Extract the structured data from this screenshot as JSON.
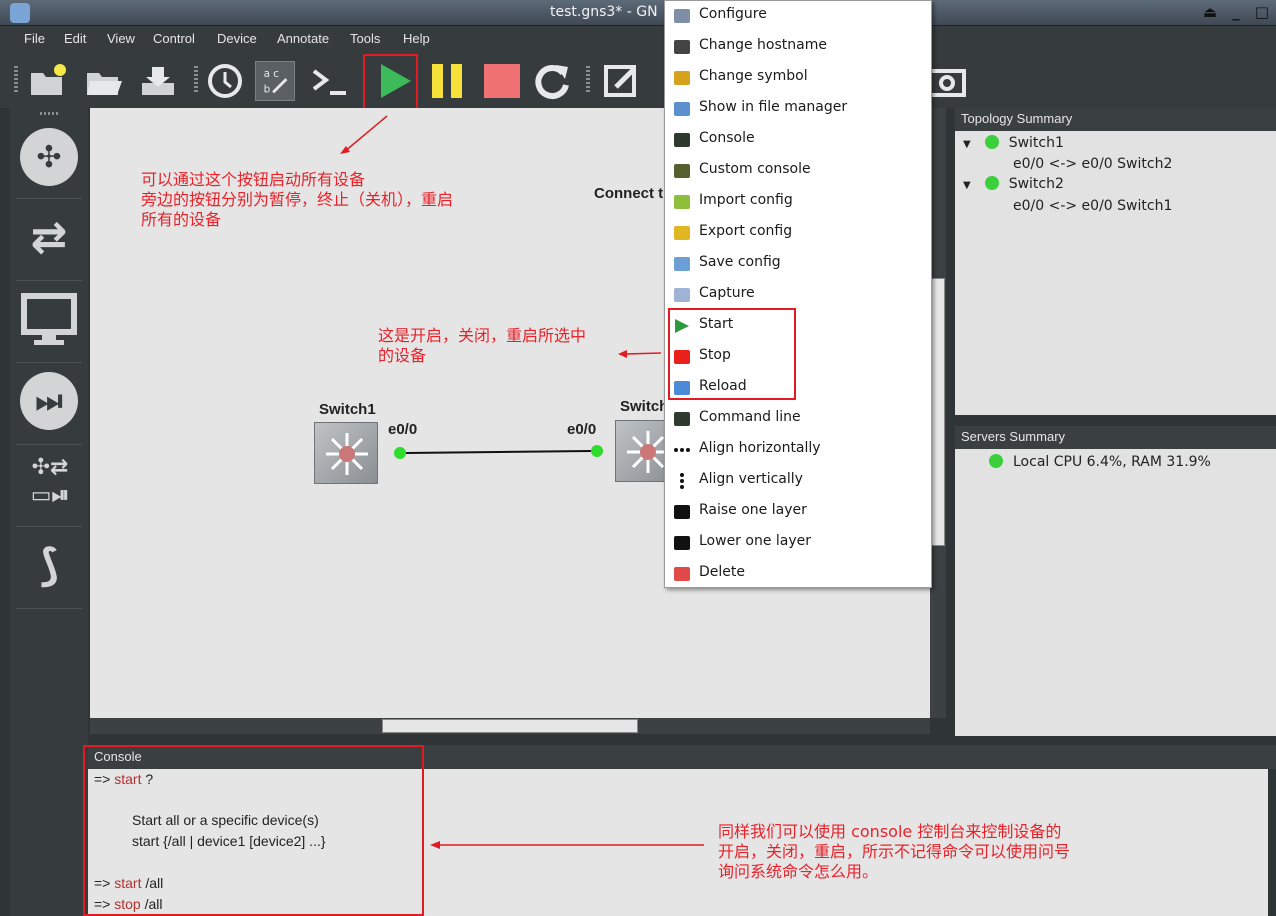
{
  "window": {
    "title": "test.gns3* - GN"
  },
  "menubar": [
    "File",
    "Edit",
    "View",
    "Control",
    "Device",
    "Annotate",
    "Tools",
    "Help"
  ],
  "toolbar_icons": [
    "new-project-icon",
    "open-project-icon",
    "save-project-icon",
    "snapshot-icon",
    "show-interface-labels-icon",
    "console-all-icon",
    "start-all-icon",
    "suspend-all-icon",
    "stop-all-icon",
    "reload-all-icon",
    "add-note-icon",
    "screenshot-icon"
  ],
  "palette_icons": [
    "routers-icon",
    "switches-icon",
    "end-devices-icon",
    "security-devices-icon",
    "all-devices-icon",
    "add-link-icon"
  ],
  "annotations": {
    "start_all": "可以通过这个按钮启动所有设备\n旁边的按钮分别为暂停，终止（关机），重启\n所有的设备",
    "selected": "这是开启，关闭，重启所选中\n的设备",
    "console": "同样我们可以使用 console 控制台来控制设备的\n开启，关闭，重启，所示不记得命令可以使用问号\n询问系统命令怎么用。"
  },
  "canvas": {
    "connect_hint": "Connect t",
    "devices": [
      {
        "name": "Switch1",
        "port": "e0/0"
      },
      {
        "name": "Switch",
        "port": "e0/0"
      }
    ]
  },
  "topology": {
    "title": "Topology Summary",
    "nodes": [
      {
        "name": "Switch1",
        "link": "e0/0 <-> e0/0 Switch2"
      },
      {
        "name": "Switch2",
        "link": "e0/0 <-> e0/0 Switch1"
      }
    ]
  },
  "servers": {
    "title": "Servers Summary",
    "local": "Local CPU 6.4%, RAM 31.9%"
  },
  "console": {
    "title": "Console",
    "prompt1": "=> ",
    "cmd1": "start",
    "arg1": " ?",
    "help1": "Start all or a specific device(s)",
    "help2": "start {/all | device1 [device2] ...}",
    "prompt2": "=> ",
    "cmd2": "start",
    "arg2": " /all",
    "prompt3": "=> ",
    "cmd3": "stop",
    "arg3": " /all"
  },
  "context_menu": [
    {
      "label": "Configure",
      "icon": "configure-icon"
    },
    {
      "label": "Change hostname",
      "icon": "hostname-icon"
    },
    {
      "label": "Change symbol",
      "icon": "symbol-icon"
    },
    {
      "label": "Show in file manager",
      "icon": "folder-icon"
    },
    {
      "label": "Console",
      "icon": "console-icon"
    },
    {
      "label": "Custom console",
      "icon": "custom-console-icon"
    },
    {
      "label": "Import config",
      "icon": "import-icon"
    },
    {
      "label": "Export config",
      "icon": "export-icon"
    },
    {
      "label": "Save config",
      "icon": "save-config-icon"
    },
    {
      "label": "Capture",
      "icon": "capture-icon"
    },
    {
      "label": "Start",
      "icon": "start-icon"
    },
    {
      "label": "Stop",
      "icon": "stop-icon"
    },
    {
      "label": "Reload",
      "icon": "reload-icon"
    },
    {
      "label": "Command line",
      "icon": "command-line-icon"
    },
    {
      "label": "Align horizontally",
      "icon": "align-horizontal-icon"
    },
    {
      "label": "Align vertically",
      "icon": "align-vertical-icon"
    },
    {
      "label": "Raise one layer",
      "icon": "raise-layer-icon"
    },
    {
      "label": "Lower one layer",
      "icon": "lower-layer-icon"
    },
    {
      "label": "Delete",
      "icon": "delete-icon"
    }
  ],
  "colors": {
    "annotation_red": "#e21b22",
    "start_green": "#3dbb5a",
    "pause_yellow": "#f6e13a",
    "stop_red": "#f07272",
    "link_led": "#2edc2e"
  }
}
